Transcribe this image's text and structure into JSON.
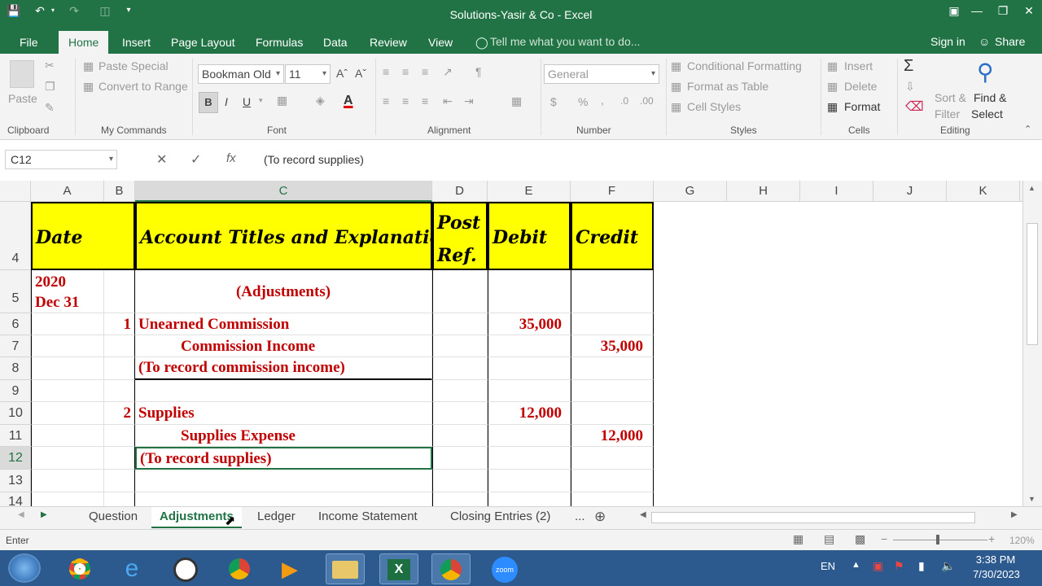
{
  "window": {
    "title": "Solutions-Yasir & Co - Excel"
  },
  "ribbon_tabs": [
    "File",
    "Home",
    "Insert",
    "Page Layout",
    "Formulas",
    "Data",
    "Review",
    "View"
  ],
  "tell_me": "Tell me what you want to do...",
  "account": {
    "signin": "Sign in",
    "share": "Share"
  },
  "clipboard": {
    "paste": "Paste",
    "group": "Clipboard"
  },
  "mycommands": {
    "paste_special": "Paste Special",
    "convert_range": "Convert to Range",
    "group": "My Commands"
  },
  "font": {
    "name": "Bookman Old",
    "size": "11",
    "group": "Font",
    "bold": "B",
    "italic": "I",
    "underline": "U",
    "color_btn": "A"
  },
  "alignment": {
    "group": "Alignment"
  },
  "number": {
    "format": "General",
    "group": "Number",
    "currency": "$",
    "percent": "%",
    "comma": ","
  },
  "styles": {
    "conditional": "Conditional Formatting",
    "table": "Format as Table",
    "cell_styles": "Cell Styles",
    "group": "Styles"
  },
  "cells": {
    "insert": "Insert",
    "delete": "Delete",
    "format": "Format",
    "group": "Cells"
  },
  "editing": {
    "sort": "Sort &",
    "filter": "Filter",
    "find": "Find &",
    "select": "Select",
    "group": "Editing"
  },
  "formula_bar": {
    "name_box": "C12",
    "content": "(To record supplies)"
  },
  "columns": [
    "A",
    "B",
    "C",
    "D",
    "E",
    "F",
    "G",
    "H",
    "I",
    "J",
    "K"
  ],
  "rows": [
    "4",
    "5",
    "6",
    "7",
    "8",
    "9",
    "10",
    "11",
    "12",
    "13",
    "14"
  ],
  "journal": {
    "headers": {
      "date": "Date",
      "account": "Account Titles and Explanation",
      "post": "Post",
      "ref": "Ref.",
      "debit": "Debit",
      "credit": "Credit"
    },
    "r5": {
      "year": "2020",
      "date": "Dec 31",
      "account": "(Adjustments)"
    },
    "r6": {
      "num": "1",
      "account": "Unearned Commission",
      "debit": "35,000"
    },
    "r7": {
      "account": "Commission Income",
      "credit": "35,000"
    },
    "r8": {
      "account": "(To record commission income)"
    },
    "r10": {
      "num": "2",
      "account": "Supplies",
      "debit": "12,000"
    },
    "r11": {
      "account": "Supplies Expense",
      "credit": "12,000"
    },
    "r12": {
      "account": "(To record supplies)"
    }
  },
  "sheet_tabs": [
    "Question",
    "Adjustments",
    "Ledger",
    "Income Statement",
    "Closing Entries (2)"
  ],
  "sheet_more": "...",
  "status": {
    "mode": "Enter",
    "zoom": "120%"
  },
  "taskbar": {
    "lang": "EN",
    "time": "3:38 PM",
    "date": "7/30/2023",
    "zoom_app": "zoom"
  }
}
